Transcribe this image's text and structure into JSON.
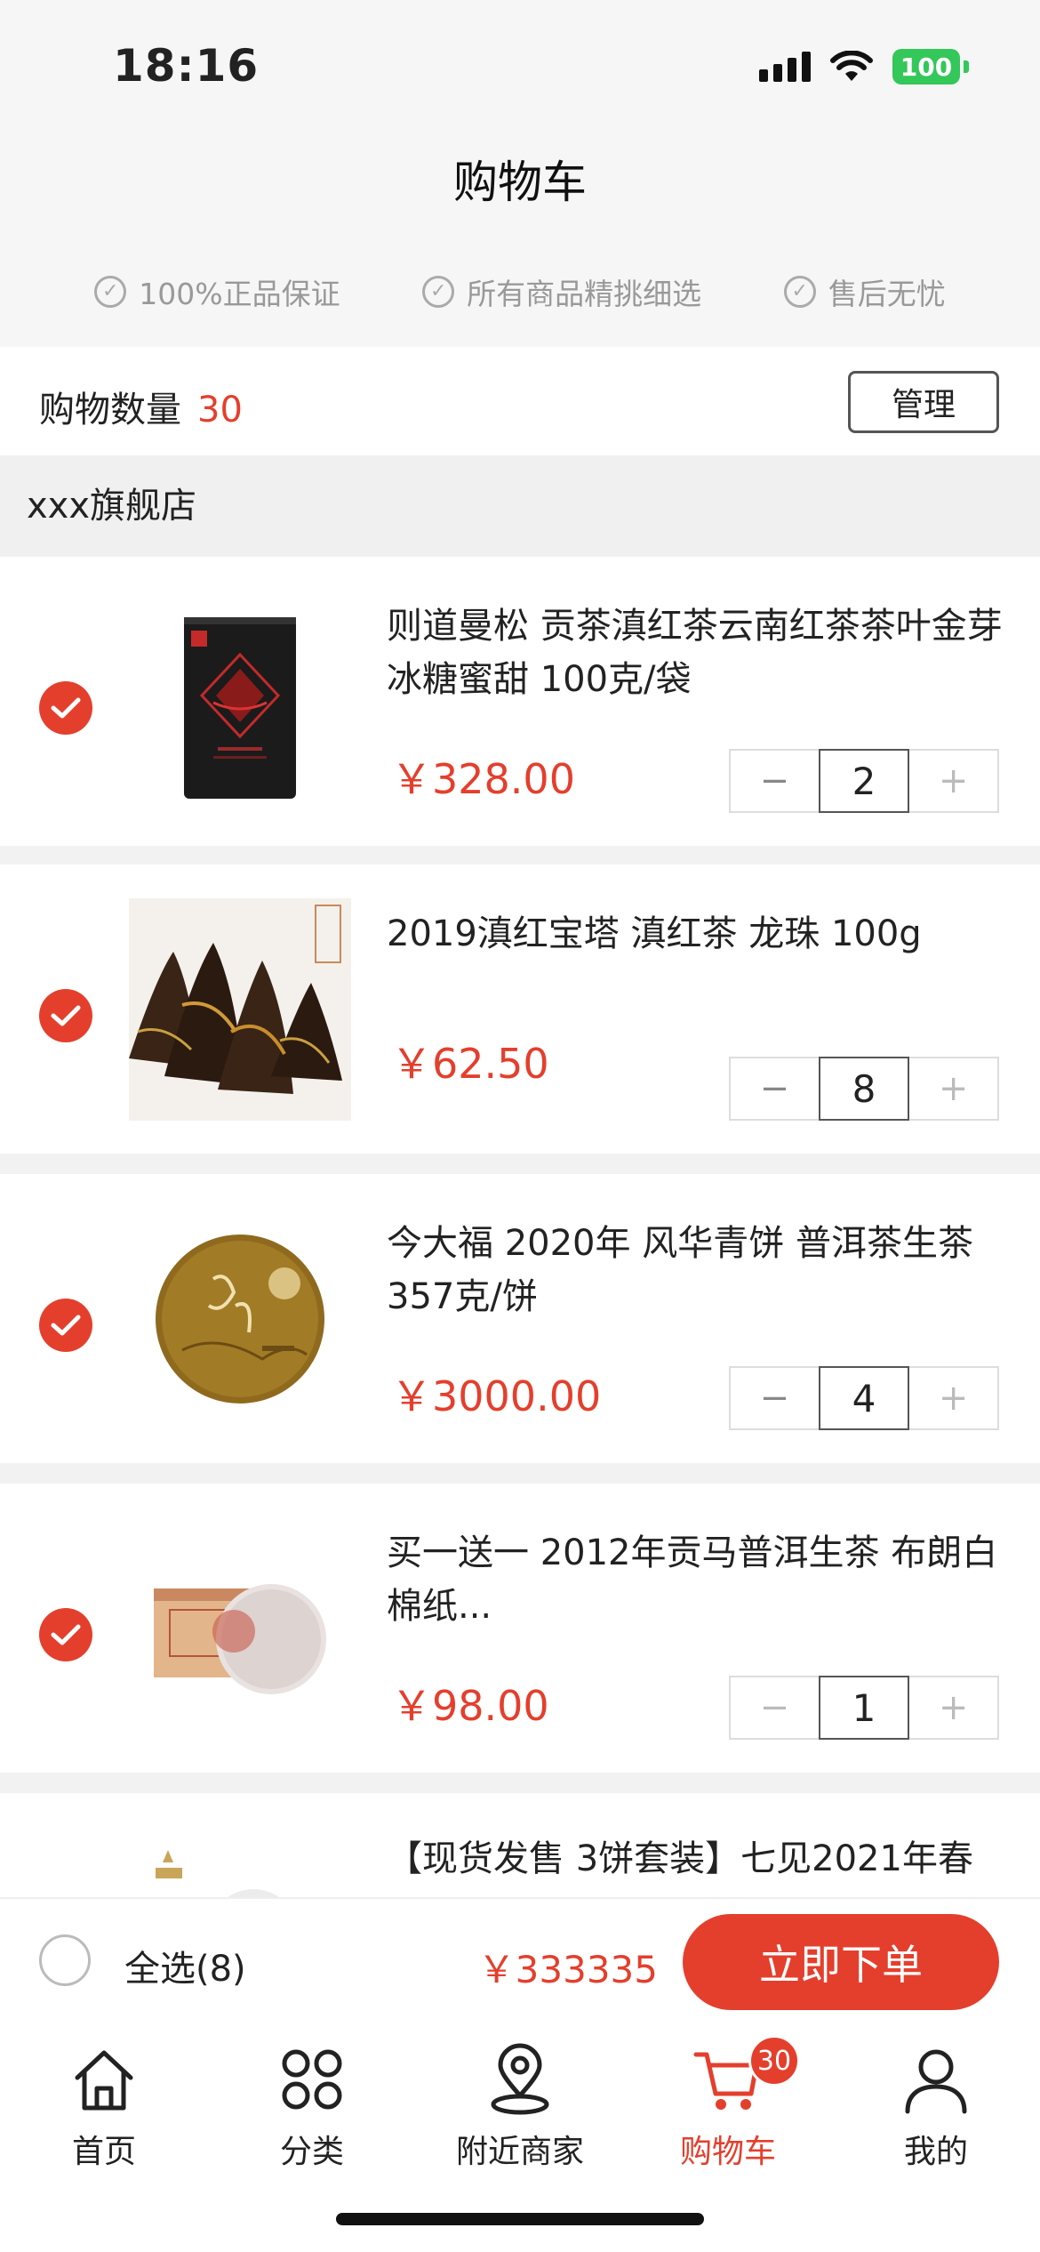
{
  "status_bar": {
    "time": "18:16",
    "battery": "100"
  },
  "nav": {
    "title": "购物车"
  },
  "guarantees": [
    "100%正品保证",
    "所有商品精挑细选",
    "售后无忧"
  ],
  "cart_summary": {
    "count_label": "购物数量",
    "count_value": "30",
    "manage_label": "管理"
  },
  "store": {
    "name": "xxx旗舰店"
  },
  "items": [
    {
      "title": "则道曼松 贡茶滇红茶云南红茶茶叶金芽冰糖蜜甜 100克/袋",
      "price": "￥328.00",
      "qty": "2",
      "selected": true
    },
    {
      "title": "2019滇红宝塔 滇红茶 龙珠 100g",
      "price": "￥62.50",
      "qty": "8",
      "selected": true
    },
    {
      "title": "今大福 2020年 风华青饼 普洱茶生茶357克/饼",
      "price": "￥3000.00",
      "qty": "4",
      "selected": true
    },
    {
      "title": "买一送一 2012年贡马普洱生茶 布朗白棉纸...",
      "price": "￥98.00",
      "qty": "1",
      "selected": true
    },
    {
      "title": "【现货发售 3饼套装】七见2021年春"
    }
  ],
  "stepper": {
    "minus": "−",
    "plus": "+"
  },
  "footer": {
    "select_all_label": "全选(8)",
    "total": "￥333335",
    "order_label": "立即下单"
  },
  "tabbar": {
    "tabs": [
      {
        "label": "首页",
        "icon": "home-icon"
      },
      {
        "label": "分类",
        "icon": "category-icon"
      },
      {
        "label": "附近商家",
        "icon": "location-icon"
      },
      {
        "label": "购物车",
        "icon": "cart-icon",
        "badge": "30",
        "active": true
      },
      {
        "label": "我的",
        "icon": "user-icon"
      }
    ]
  },
  "colors": {
    "accent": "#e43f2d",
    "battery": "#34c759"
  }
}
